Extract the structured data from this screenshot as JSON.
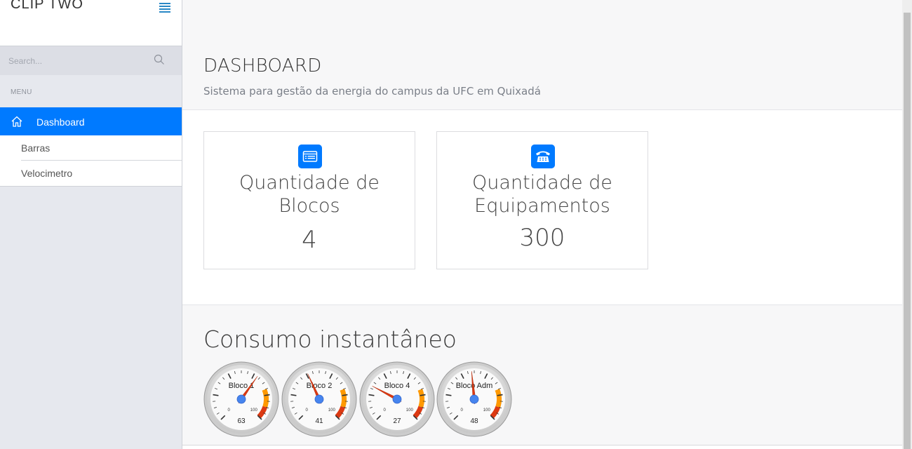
{
  "brand": {
    "title": "CLIP TWO"
  },
  "search": {
    "placeholder": "Search..."
  },
  "sidebar": {
    "menu_heading": "MENU",
    "active_item": {
      "label": "Dashboard",
      "icon": "home-icon"
    },
    "sub_items": [
      {
        "label": "Barras"
      },
      {
        "label": "Velocimetro"
      }
    ]
  },
  "header": {
    "title": "DASHBOARD",
    "subtitle": "Sistema para gestão da energia do campus da UFC em Quixadá"
  },
  "cards": [
    {
      "title_lines": [
        "Quantidade de",
        "Blocos"
      ],
      "value": "4",
      "icon": "list-icon"
    },
    {
      "title_lines": [
        "Quantidade de",
        "Equipamentos"
      ],
      "value": "300",
      "icon": "phone-icon"
    }
  ],
  "gauges_section": {
    "title": "Consumo instantâneo",
    "gauges": [
      {
        "label": "Bloco 1",
        "value": 63,
        "min": 0,
        "max": 100
      },
      {
        "label": "Bloco 2",
        "value": 41,
        "min": 0,
        "max": 100
      },
      {
        "label": "Bloco 4",
        "value": 27,
        "min": 0,
        "max": 100
      },
      {
        "label": "Bloco Adm",
        "value": 48,
        "min": 0,
        "max": 100
      }
    ]
  },
  "colors": {
    "accent": "#007aff",
    "gauge_yellow": "#f4c542",
    "gauge_orange": "#ff9900",
    "gauge_red": "#dc3912",
    "needle": "#dc3912",
    "needle_hub": "#4684ee"
  }
}
